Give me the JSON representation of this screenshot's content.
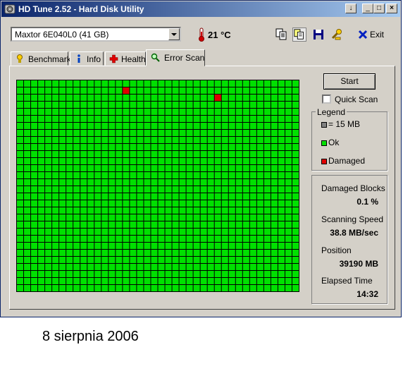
{
  "window": {
    "title": "HD Tune 2.52 - Hard Disk Utility",
    "controls": [
      "↓",
      "_",
      "□",
      "×"
    ]
  },
  "toolbar": {
    "drive": "Maxtor 6E040L0 (41 GB)",
    "temperature": "21 °C",
    "exit_label": "Exit",
    "icons": [
      "copy-icon",
      "copy-screen-icon",
      "save-icon",
      "options-icon",
      "exit-icon"
    ]
  },
  "tabs": [
    {
      "label": "Benchmark",
      "icon": "benchmark-icon"
    },
    {
      "label": "Info",
      "icon": "info-icon"
    },
    {
      "label": "Health",
      "icon": "health-icon"
    },
    {
      "label": "Error Scan",
      "icon": "magnifier-icon",
      "active": true
    }
  ],
  "scan": {
    "start_label": "Start",
    "quick_scan_label": "Quick Scan",
    "quick_scan_checked": false,
    "grid_columns": 40,
    "grid_rows": 30,
    "damaged_blocks": [
      [
        15,
        1
      ],
      [
        28,
        2
      ]
    ],
    "ok_color": "#00e000",
    "damaged_color": "#e00000",
    "block_color": "#808080"
  },
  "legend": {
    "title": "Legend",
    "block_label": "= 15 MB",
    "ok_label": "Ok",
    "damaged_label": "Damaged"
  },
  "stats": {
    "damaged_blocks_label": "Damaged Blocks",
    "damaged_blocks_value": "0.1 %",
    "speed_label": "Scanning Speed",
    "speed_value": "38.8 MB/sec",
    "position_label": "Position",
    "position_value": "39190 MB",
    "elapsed_label": "Elapsed Time",
    "elapsed_value": "14:32"
  },
  "caption": "8 sierpnia 2006"
}
